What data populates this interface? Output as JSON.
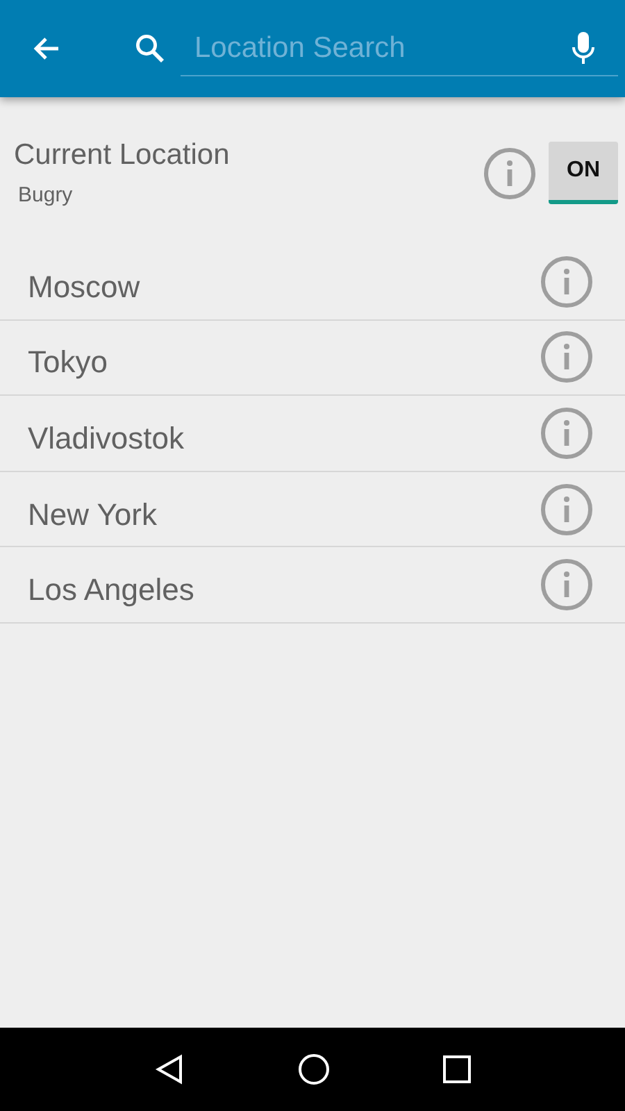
{
  "search": {
    "placeholder": "Location Search"
  },
  "current_location": {
    "title": "Current Location",
    "place": "Bugry",
    "toggle": {
      "label": "ON",
      "on": true
    }
  },
  "locations": [
    {
      "name": "Moscow"
    },
    {
      "name": "Tokyo"
    },
    {
      "name": "Vladivostok"
    },
    {
      "name": "New York"
    },
    {
      "name": "Los Angeles"
    }
  ]
}
